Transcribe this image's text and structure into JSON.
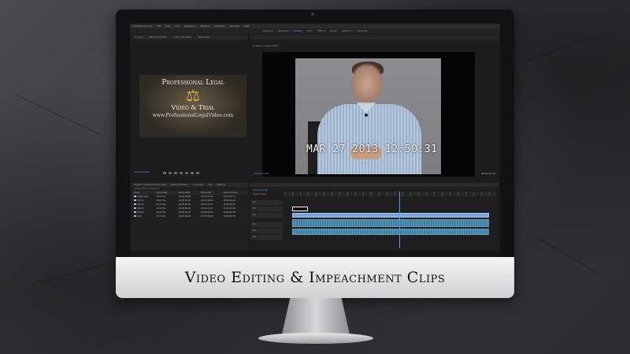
{
  "banner": {
    "title": "Video Editing & Impeachment Clips"
  },
  "premiere": {
    "menu": [
      "Premiere Pro CC",
      "File",
      "Edit",
      "Clip",
      "Sequence",
      "Markers",
      "Graphics",
      "Window",
      "Help"
    ],
    "workspaces": [
      {
        "label": "Learning",
        "active": false
      },
      {
        "label": "Assembly",
        "active": false
      },
      {
        "label": "Editing",
        "active": true
      },
      {
        "label": "Color",
        "active": false
      },
      {
        "label": "Effects",
        "active": false
      },
      {
        "label": "Audio",
        "active": false
      },
      {
        "label": "Graphics",
        "active": false
      },
      {
        "label": "Libraries",
        "active": false
      }
    ],
    "source": {
      "tabs": [
        "Source",
        "Effect Controls",
        "Audio Clip Mixer",
        "Metadata"
      ],
      "image": {
        "line1": "Professional Legal",
        "line2": "Video & Trial",
        "line3": "www.ProfessionalLegalVideo.com"
      },
      "timecode": "00:00:00:00"
    },
    "program": {
      "tab": "Program: Legal Video",
      "overlay_text": "MAR 27 2013 12:50:31",
      "timecode": "00:00:12:08",
      "duration": "00:01:24:16"
    },
    "project": {
      "tabs": [
        "Project: Impeachment Clips",
        "Media Browser",
        "Libraries",
        "Info",
        "Effects"
      ],
      "path": "Impeachment Clips.prproj",
      "columns": [
        "Name",
        "Frame Rate",
        "Media Start",
        "Media End",
        "Media Duration"
      ],
      "rows": [
        [
          "Legal Video",
          "29.97 fps",
          "00:00:00:00",
          "00:01:24:16",
          "00:01:24:17"
        ],
        [
          "Clip 01",
          "29.97 fps",
          "00:00:00:00",
          "00:00:18:02",
          "00:00:18:03"
        ],
        [
          "Clip 02",
          "29.97 fps",
          "00:00:00:00",
          "00:00:22:11",
          "00:00:22:12"
        ],
        [
          "Clip 03",
          "29.97 fps",
          "00:00:00:00",
          "00:00:15:27",
          "00:00:15:28"
        ],
        [
          "Clip 04",
          "29.97 fps",
          "00:00:00:00",
          "00:00:09:14",
          "00:00:09:15"
        ],
        [
          "Logo",
          "29.97 fps",
          "00:00:00:00",
          "00:00:05:00",
          "00:00:05:01"
        ]
      ]
    },
    "timeline": {
      "tab": "Legal Video",
      "timecode": "00:00:12:08",
      "tracks": [
        "V3",
        "V2",
        "V1",
        "A1",
        "A2",
        "A3"
      ]
    }
  }
}
